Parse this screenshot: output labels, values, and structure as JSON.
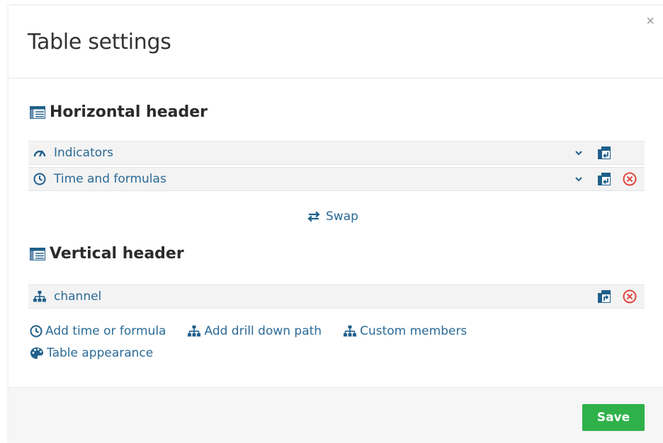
{
  "dialog": {
    "title": "Table settings",
    "close_label": "×"
  },
  "horizontal_header": {
    "title": "Horizontal header",
    "items": [
      {
        "label": "Indicators",
        "icon": "gauge-icon",
        "removable": false
      },
      {
        "label": "Time and formulas",
        "icon": "clock-icon",
        "removable": true
      }
    ]
  },
  "swap": {
    "label": "Swap",
    "icon": "swap-arrows-icon"
  },
  "vertical_header": {
    "title": "Vertical header",
    "items": [
      {
        "label": "channel",
        "icon": "sitemap-icon",
        "removable": true
      }
    ]
  },
  "actions": {
    "add_time_formula": "Add time or formula",
    "add_drill_down": "Add drill down path",
    "custom_members": "Custom members",
    "table_appearance": "Table appearance"
  },
  "footer": {
    "save_label": "Save"
  },
  "colors": {
    "link": "#2a6a96",
    "save": "#2fb14a",
    "remove": "#e0463f"
  }
}
